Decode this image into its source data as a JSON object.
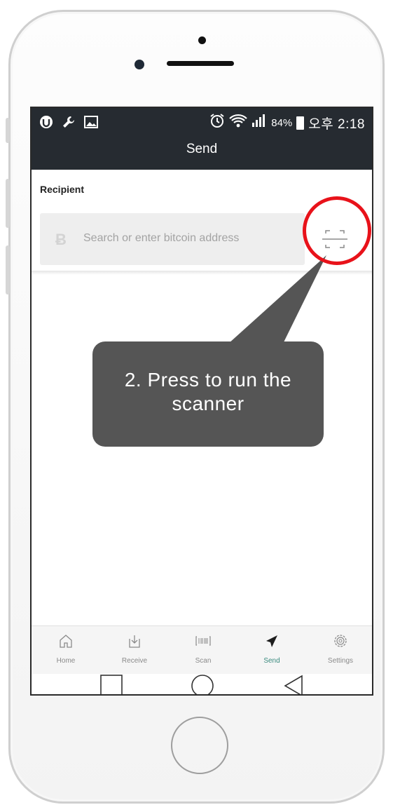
{
  "statusbar": {
    "battery_percent": "84%",
    "time": "오후 2:18",
    "left_icons": [
      "app-icon",
      "wrench-icon",
      "image-icon"
    ],
    "right_icons": [
      "alarm-icon",
      "wifi-icon",
      "signal-icon",
      "battery-icon"
    ]
  },
  "header": {
    "title": "Send"
  },
  "recipient": {
    "label": "Recipient",
    "placeholder": "Search or enter bitcoin address",
    "currency_icon": "bitcoin-icon",
    "scan_icon": "scan-qr-icon"
  },
  "tabs": [
    {
      "label": "Home",
      "icon": "home-icon",
      "active": false
    },
    {
      "label": "Receive",
      "icon": "receive-icon",
      "active": false
    },
    {
      "label": "Scan",
      "icon": "barcode-icon",
      "active": false
    },
    {
      "label": "Send",
      "icon": "send-icon",
      "active": true
    },
    {
      "label": "Settings",
      "icon": "gear-icon",
      "active": false
    }
  ],
  "android_nav": [
    "recent-apps-icon",
    "home-circle-icon",
    "back-icon"
  ],
  "annotation": {
    "text": "2. Press to run the scanner"
  },
  "colors": {
    "header_bg": "#262b31",
    "accent_active_tab": "#3a8a7e",
    "annotation_ring": "#e8121a",
    "callout_bg": "#555555"
  }
}
